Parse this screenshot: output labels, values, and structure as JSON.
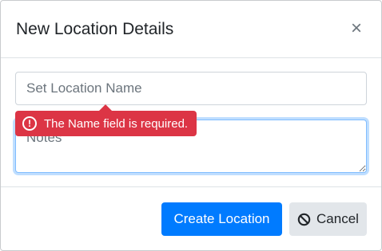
{
  "modal": {
    "title": "New Location Details",
    "close_glyph": "×"
  },
  "form": {
    "name_placeholder": "Set Location Name",
    "name_value": "",
    "notes_placeholder": "Notes",
    "notes_value": ""
  },
  "validation": {
    "icon": "exclamation-circle-icon",
    "icon_glyph": "!",
    "message": "The Name field is required.",
    "color": "#dc3545"
  },
  "footer": {
    "create_label": "Create Location",
    "cancel_label": "Cancel",
    "cancel_icon": "ban-icon"
  },
  "colors": {
    "primary": "#007bff",
    "secondary_bg": "#e2e6ea",
    "focus_border": "#80bdff"
  }
}
